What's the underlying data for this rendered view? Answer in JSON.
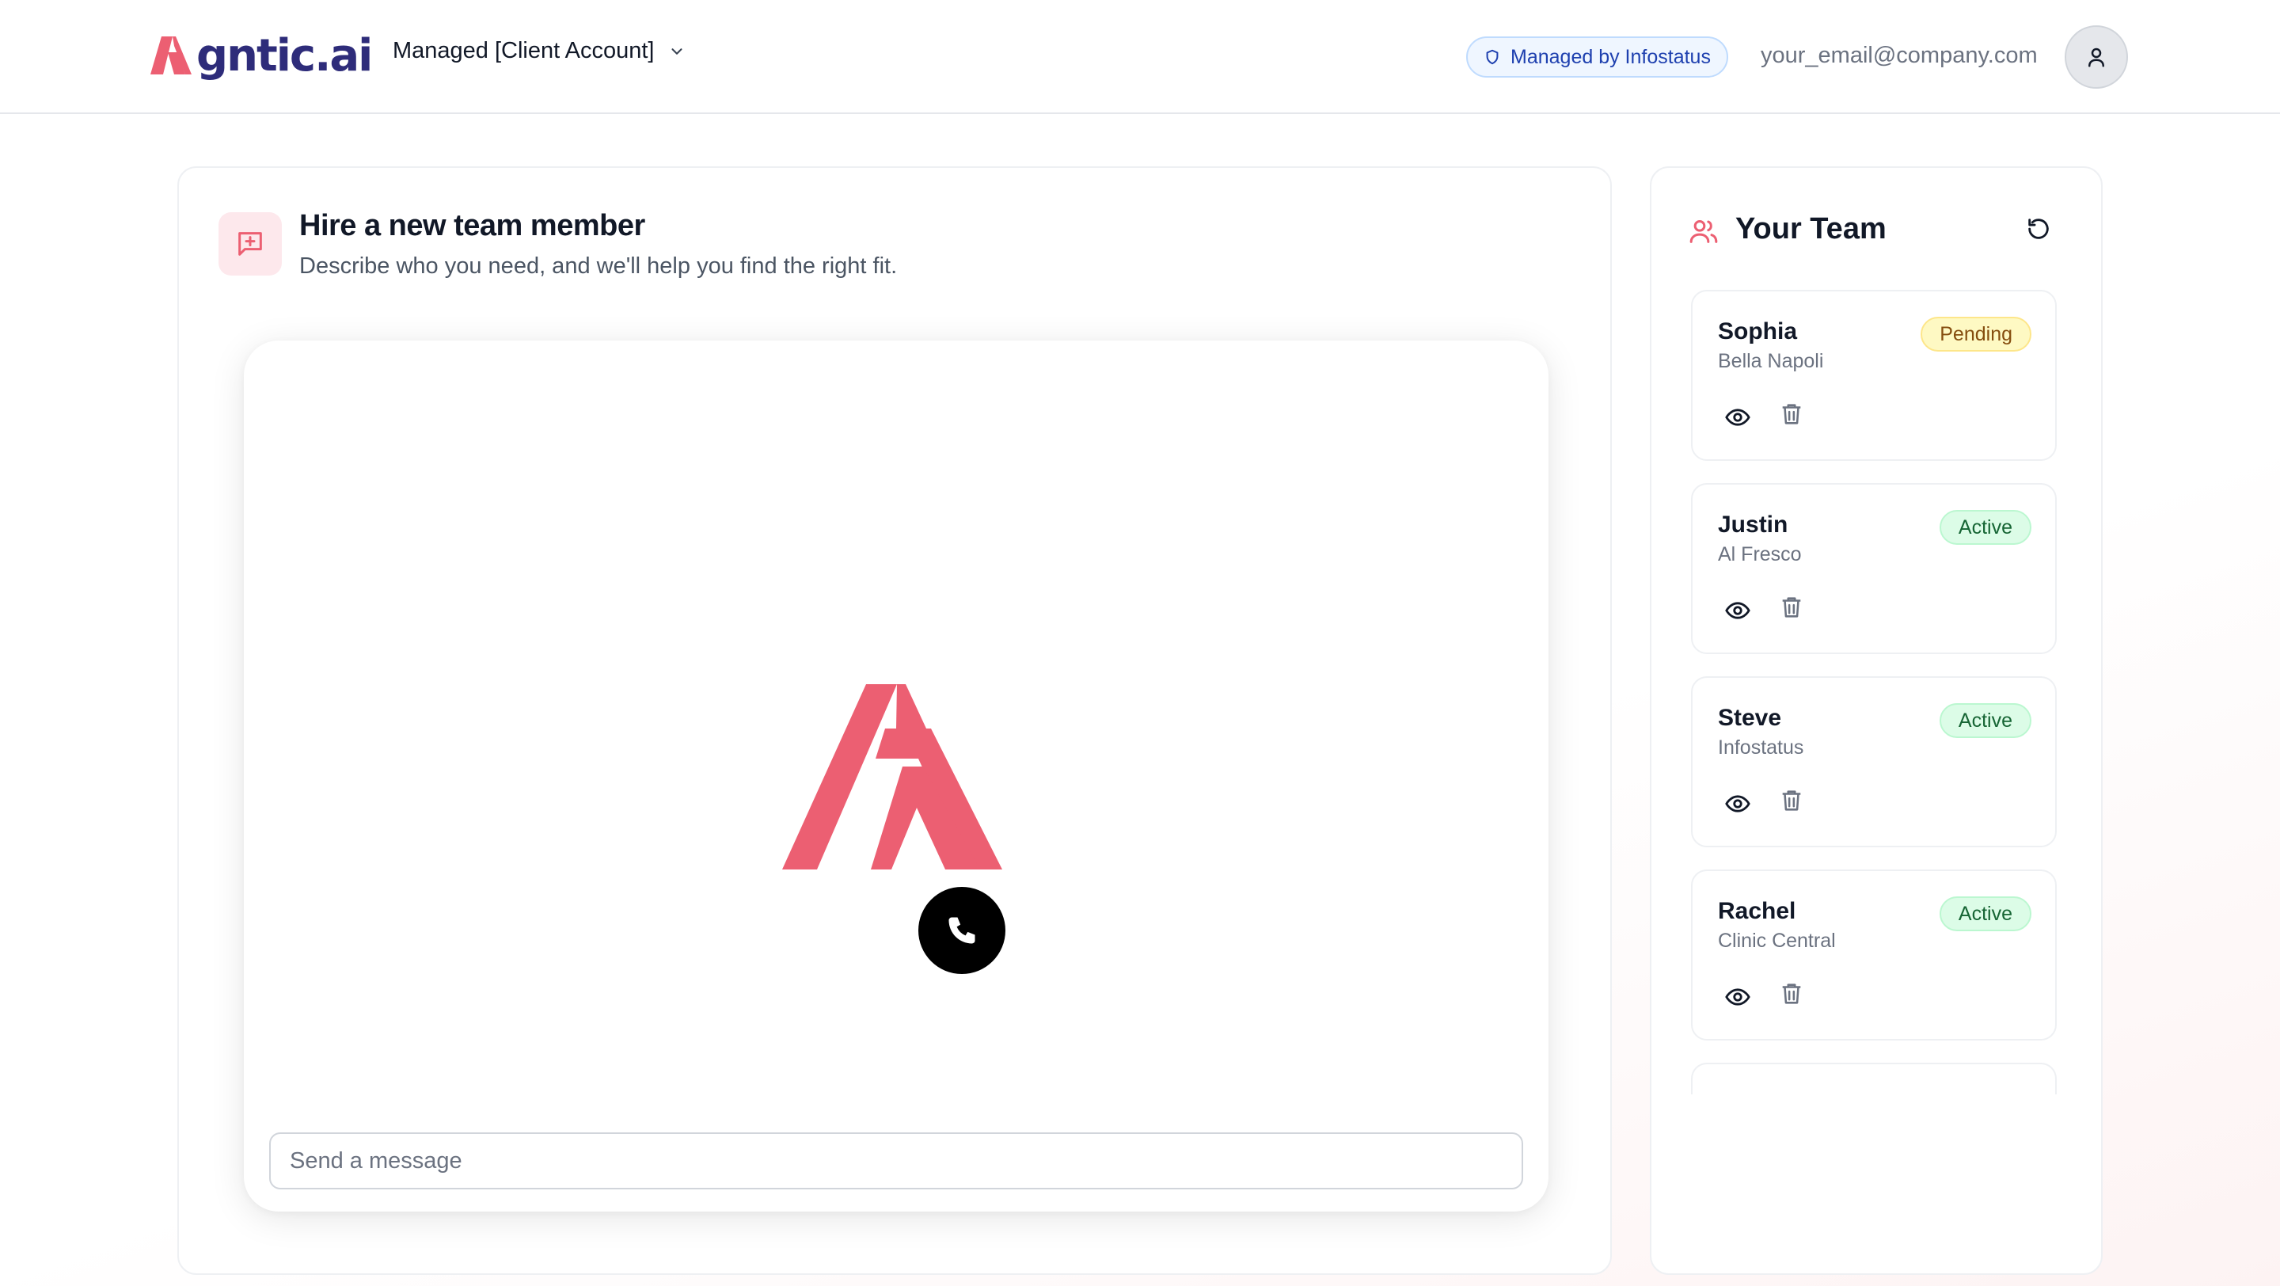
{
  "header": {
    "logo_text": "gntic.ai",
    "logo_colors": {
      "mark": "#ec5f72",
      "text": "#2e2c7a"
    },
    "account_label": "Managed [Client Account]",
    "managed_badge": "Managed by Infostatus",
    "user_email": "your_email@company.com"
  },
  "hire": {
    "title": "Hire a new team member",
    "subtitle": "Describe who you need, and we'll help you find the right fit.",
    "message_placeholder": "Send a message",
    "message_value": ""
  },
  "team": {
    "title": "Your Team",
    "members": [
      {
        "name": "Sophia",
        "company": "Bella Napoli",
        "status": "Pending"
      },
      {
        "name": "Justin",
        "company": "Al Fresco",
        "status": "Active"
      },
      {
        "name": "Steve",
        "company": "Infostatus",
        "status": "Active"
      },
      {
        "name": "Rachel",
        "company": "Clinic Central",
        "status": "Active"
      }
    ]
  },
  "colors": {
    "accent": "#ec5f72",
    "pending": "#fef9c3",
    "active": "#dcfce7"
  }
}
